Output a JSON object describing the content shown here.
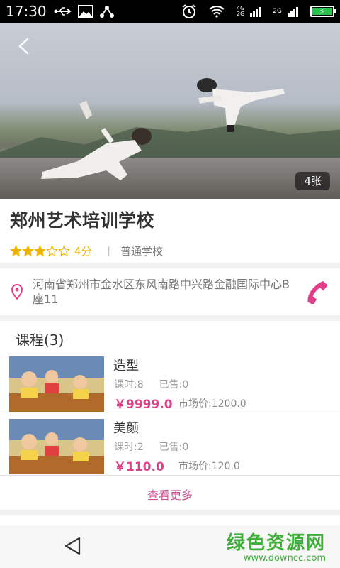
{
  "status_bar": {
    "time": "17:30",
    "icons_left": [
      "usb-icon",
      "image-icon",
      "share-icon"
    ],
    "icons_right": [
      "alarm-icon",
      "wifi-icon",
      "signal-4g-icon",
      "signal-2g-icon",
      "battery-charging-icon"
    ],
    "net_top": "4G",
    "net_bottom": "2G",
    "net2": "2G"
  },
  "hero": {
    "photo_count": "4张"
  },
  "school": {
    "name": "郑州艺术培训学校",
    "rating": 3,
    "rating_max": 5,
    "score": "4分",
    "separator": "|",
    "type": "普通学校"
  },
  "address": {
    "text": "河南省郑州市金水区东风南路中兴路金融国际中心B座11"
  },
  "courses": {
    "title": "课程(3)",
    "items": [
      {
        "name": "造型",
        "hours": "课时:8",
        "sold": "已售:0",
        "price": "￥9999.0",
        "market_price": "市场价:1200.0"
      },
      {
        "name": "美颜",
        "hours": "课时:2",
        "sold": "已售:0",
        "price": "￥110.0",
        "market_price": "市场价:120.0"
      }
    ],
    "see_more": "查看更多"
  },
  "watermark": {
    "cn": "绿色资源网",
    "url": "www.downcc.com"
  },
  "colors": {
    "accent": "#e0408a",
    "star": "#f0b400",
    "watermark": "#3fae3a"
  }
}
